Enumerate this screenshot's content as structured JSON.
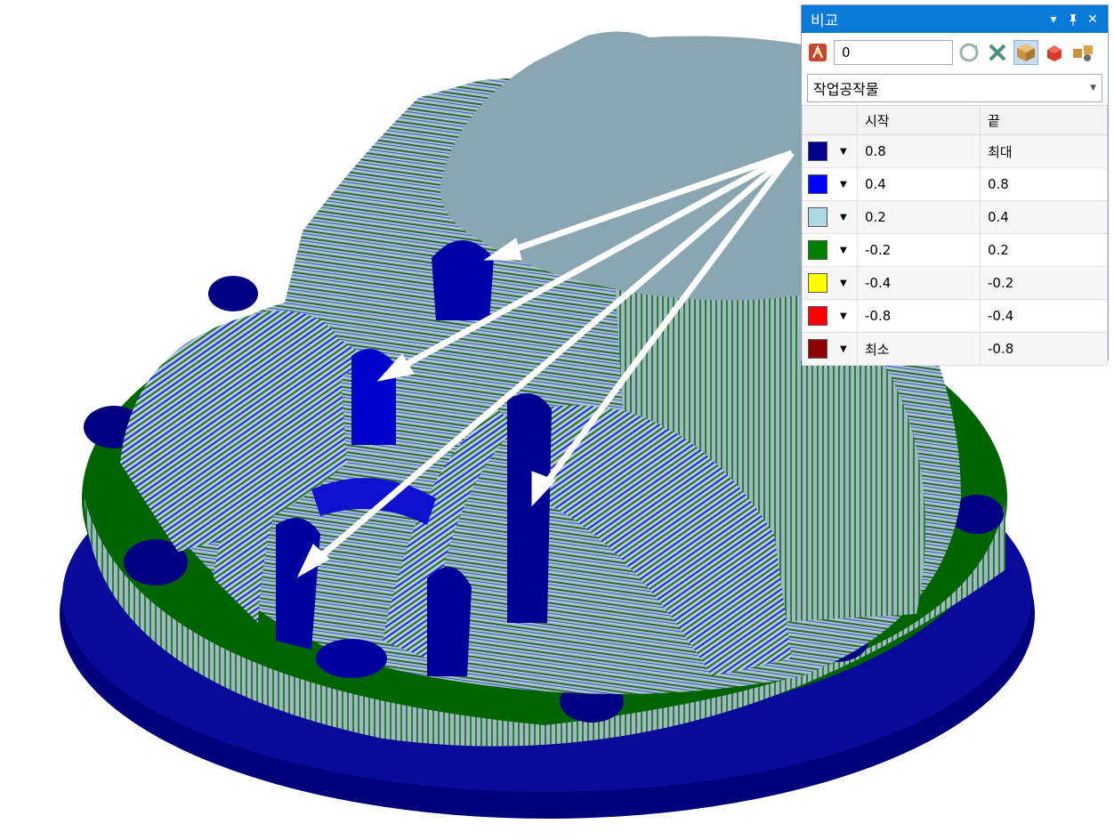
{
  "panel": {
    "title": "비교",
    "title_buttons": [
      "▾",
      "⊤",
      "✕"
    ],
    "value": "0",
    "source_select": "작업공작물",
    "columns": [
      "",
      "시작",
      "끝"
    ],
    "rows": [
      {
        "color": "#00008b",
        "start": "0.8",
        "end": "최대"
      },
      {
        "color": "#0000ff",
        "start": "0.4",
        "end": "0.8"
      },
      {
        "color": "#add8e6",
        "start": "0.2",
        "end": "0.4"
      },
      {
        "color": "#008000",
        "start": "-0.2",
        "end": "0.2"
      },
      {
        "color": "#ffff00",
        "start": "-0.4",
        "end": "-0.2"
      },
      {
        "color": "#ff0000",
        "start": "-0.8",
        "end": "-0.4"
      },
      {
        "color": "#8b0000",
        "start": "최소",
        "end": "-0.8"
      }
    ],
    "toolbar_icons": [
      "gauge-icon",
      "refresh-icon",
      "clear-icon",
      "stock-box-icon",
      "model-icon",
      "compare-settings-icon"
    ]
  },
  "colors": {
    "title_bar": "#0a7ad8",
    "model_top": "#8aa7b1",
    "base_plate": "#00007a",
    "flange": "#006600"
  }
}
